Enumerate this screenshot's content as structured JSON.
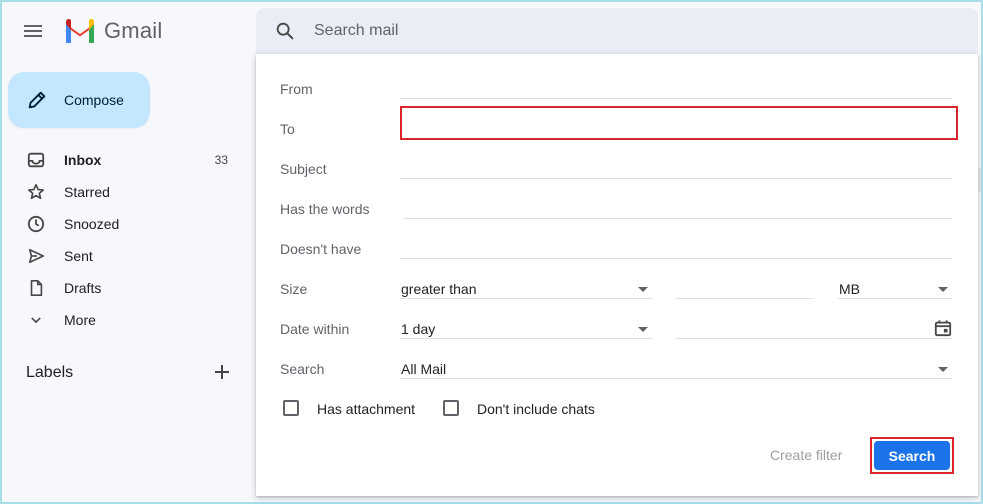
{
  "header": {
    "logo_text": "Gmail",
    "search_placeholder": "Search mail"
  },
  "compose": {
    "label": "Compose"
  },
  "nav": {
    "items": [
      {
        "label": "Inbox",
        "count": "33",
        "icon": "inbox-icon"
      },
      {
        "label": "Starred",
        "icon": "star-icon"
      },
      {
        "label": "Snoozed",
        "icon": "clock-icon"
      },
      {
        "label": "Sent",
        "icon": "send-icon"
      },
      {
        "label": "Drafts",
        "icon": "draft-icon"
      },
      {
        "label": "More",
        "icon": "chevron-down-icon"
      }
    ]
  },
  "labels": {
    "title": "Labels"
  },
  "search_form": {
    "from_label": "From",
    "to_label": "To",
    "subject_label": "Subject",
    "has_words_label": "Has the words",
    "doesnt_have_label": "Doesn't have",
    "size_label": "Size",
    "size_operator": "greater than",
    "size_unit": "MB",
    "date_within_label": "Date within",
    "date_within_value": "1 day",
    "search_in_label": "Search",
    "search_in_value": "All Mail",
    "has_attachment_label": "Has attachment",
    "dont_include_chats_label": "Don't include chats",
    "create_filter_label": "Create filter",
    "search_button_label": "Search"
  },
  "colors": {
    "accent": "#1a73e8",
    "compose_bg": "#c2e7ff",
    "highlight": "#d9262b"
  }
}
